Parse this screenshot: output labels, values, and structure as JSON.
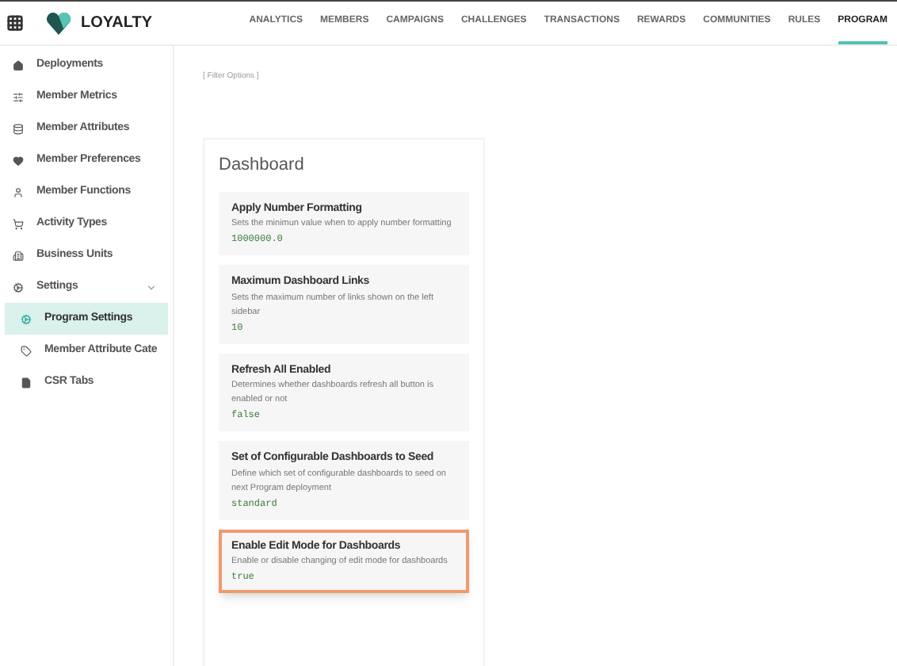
{
  "brand": "LOYALTY",
  "nav": [
    {
      "label": "ANALYTICS",
      "selected": false
    },
    {
      "label": "MEMBERS",
      "selected": false
    },
    {
      "label": "CAMPAIGNS",
      "selected": false
    },
    {
      "label": "CHALLENGES",
      "selected": false
    },
    {
      "label": "TRANSACTIONS",
      "selected": false
    },
    {
      "label": "REWARDS",
      "selected": false
    },
    {
      "label": "COMMUNITIES",
      "selected": false
    },
    {
      "label": "RULES",
      "selected": false
    },
    {
      "label": "PROGRAM",
      "selected": true
    }
  ],
  "sidebar": {
    "items": [
      {
        "label": "Deployments",
        "kind": "home",
        "selected": false
      },
      {
        "label": "Member Metrics",
        "kind": "sliders",
        "selected": false
      },
      {
        "label": "Member Attributes",
        "kind": "database",
        "selected": false
      },
      {
        "label": "Member Preferences",
        "kind": "heart",
        "selected": false
      },
      {
        "label": "Member Functions",
        "kind": "user",
        "selected": false
      },
      {
        "label": "Activity Types",
        "kind": "cart",
        "selected": false
      },
      {
        "label": "Business Units",
        "kind": "building",
        "selected": false
      },
      {
        "label": "Settings",
        "kind": "gears",
        "selected": false,
        "expanded": true,
        "children": [
          {
            "label": "Program Settings",
            "kind": "gears",
            "selected": true
          },
          {
            "label": "Member Attribute Cate",
            "kind": "tag",
            "selected": false
          },
          {
            "label": "CSR Tabs",
            "kind": "file",
            "selected": false
          }
        ]
      }
    ]
  },
  "filter_options": "[ Filter Options ]",
  "panel": {
    "title": "Dashboard",
    "settings": [
      {
        "name": "Apply Number Formatting",
        "description": "Sets the minimun value when to apply number formatting",
        "value": "1000000.0",
        "highlighted": false
      },
      {
        "name": "Maximum Dashboard Links",
        "description": "Sets the maximum number of links shown on the left sidebar",
        "value": "10",
        "highlighted": false
      },
      {
        "name": "Refresh All Enabled",
        "description": "Determines whether dashboards refresh all button is enabled or not",
        "value": "false",
        "highlighted": false
      },
      {
        "name": "Set of Configurable Dashboards to Seed",
        "description": "Define which set of configurable dashboards to seed on next Program deployment",
        "value": "standard",
        "highlighted": false
      },
      {
        "name": "Enable Edit Mode for Dashboards",
        "description": "Enable or disable changing of edit mode for dashboards",
        "value": "true",
        "highlighted": true
      }
    ]
  }
}
